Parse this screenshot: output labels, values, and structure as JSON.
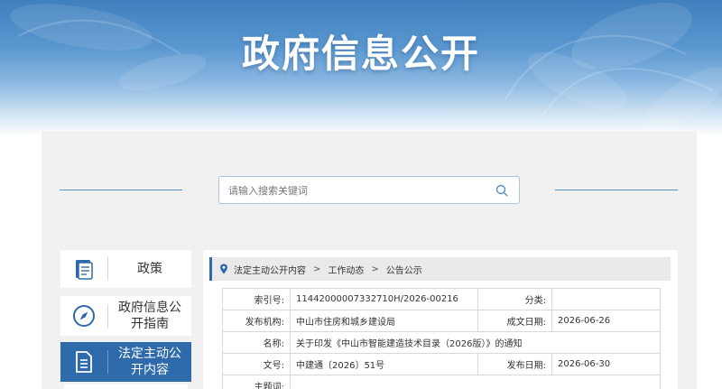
{
  "banner": {
    "title": "政府信息公开"
  },
  "search": {
    "placeholder": "请输入搜索关键词"
  },
  "sidebar": {
    "items": [
      {
        "label": "政策",
        "icon": "book-icon",
        "active": false
      },
      {
        "label": "政府信息公开指南",
        "icon": "compass-icon",
        "active": false
      },
      {
        "label": "法定主动公开内容",
        "icon": "document-icon",
        "active": true
      }
    ]
  },
  "breadcrumb": {
    "items": [
      "法定主动公开内容",
      "工作动态",
      "公告公示"
    ]
  },
  "info": {
    "index_label": "索引号:",
    "index_value": "11442000007332710H/2026-00216",
    "category_label": "分类:",
    "category_value": "",
    "publisher_label": "发布机构:",
    "publisher_value": "中山市住房和城乡建设局",
    "created_label": "成文日期:",
    "created_value": "2026-06-26",
    "name_label": "名称:",
    "name_value": "关于印发《中山市智能建造技术目录（2026版）》的通知",
    "docno_label": "文号:",
    "docno_value": "中建通〔2026〕51号",
    "published_label": "发布日期:",
    "published_value": "2026-06-30",
    "topic_label": "主题词:"
  },
  "colors": {
    "accent": "#2f6bab",
    "banner_top": "#3f7fbd",
    "panel_bg": "#f1f1f1"
  }
}
